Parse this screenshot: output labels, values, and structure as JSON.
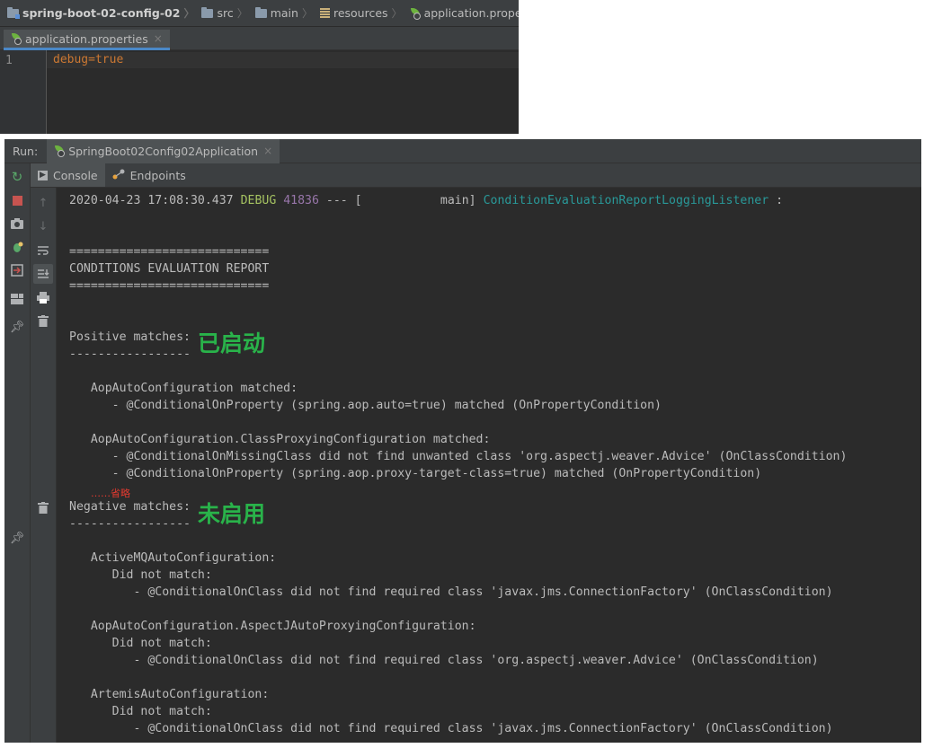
{
  "editor": {
    "breadcrumb": [
      {
        "label": "spring-boot-02-config-02",
        "icon": "module-folder-icon"
      },
      {
        "label": "src",
        "icon": "folder-icon"
      },
      {
        "label": "main",
        "icon": "folder-icon"
      },
      {
        "label": "resources",
        "icon": "resources-folder-icon"
      },
      {
        "label": "application.properties",
        "icon": "spring-properties-icon"
      }
    ],
    "tab": {
      "label": "application.properties",
      "close": "×"
    },
    "line_number": "1",
    "code": "debug=true"
  },
  "run": {
    "label": "Run:",
    "tab": {
      "label": "SpringBoot02Config02Application",
      "close": "×"
    },
    "subtabs": [
      {
        "label": "Console",
        "icon": "console-icon"
      },
      {
        "label": "Endpoints",
        "icon": "endpoints-icon"
      }
    ],
    "log": {
      "timestamp": "2020-04-23 17:08:30.437",
      "level": "DEBUG",
      "pid": "41836",
      "separator": "--- [           main]",
      "logger": "ConditionEvaluationReportLoggingListener",
      "colon": ":"
    },
    "lines": {
      "sep1": "============================",
      "report_title": "CONDITIONS EVALUATION REPORT",
      "sep2": "============================",
      "positive": "Positive matches:",
      "dash1": "-----------------",
      "aop": "   AopAutoConfiguration matched:",
      "aop_1": "      - @ConditionalOnProperty (spring.aop.auto=true) matched (OnPropertyCondition)",
      "aop_proxy": "   AopAutoConfiguration.ClassProxyingConfiguration matched:",
      "aop_proxy_1": "      - @ConditionalOnMissingClass did not find unwanted class 'org.aspectj.weaver.Advice' (OnClassCondition)",
      "aop_proxy_2": "      - @ConditionalOnProperty (spring.aop.proxy-target-class=true) matched (OnPropertyCondition)",
      "negative": "Negative matches:",
      "dash2": "-----------------",
      "activemq": "   ActiveMQAutoConfiguration:",
      "activemq_1": "      Did not match:",
      "activemq_2": "         - @ConditionalOnClass did not find required class 'javax.jms.ConnectionFactory' (OnClassCondition)",
      "aspectj": "   AopAutoConfiguration.AspectJAutoProxyingConfiguration:",
      "aspectj_1": "      Did not match:",
      "aspectj_2": "         - @ConditionalOnClass did not find required class 'org.aspectj.weaver.Advice' (OnClassCondition)",
      "artemis": "   ArtemisAutoConfiguration:",
      "artemis_1": "      Did not match:",
      "artemis_2": "         - @ConditionalOnClass did not find required class 'javax.jms.ConnectionFactory' (OnClassCondition)"
    },
    "annotations": {
      "enabled": "已启动",
      "disabled": "未启用",
      "omitted": "……省略"
    }
  },
  "colors": {
    "annotation_green": "#29b34a",
    "omitted_red": "#e23a2f",
    "debug_green": "#a5c261",
    "pid_purple": "#9876aa",
    "logger_teal": "#299999",
    "code_orange": "#cc7832"
  }
}
